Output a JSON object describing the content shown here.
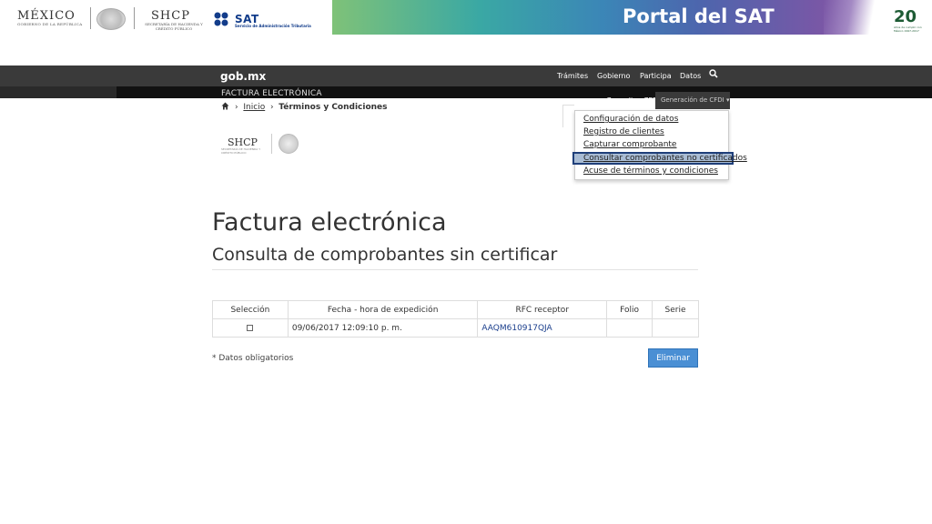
{
  "banner": {
    "mexico_title": "MÉXICO",
    "mexico_sub": "GOBIERNO DE LA REPÚBLICA",
    "shcp_title": "SHCP",
    "shcp_sub": "SECRETARÍA DE HACIENDA Y CRÉDITO PÚBLICO",
    "sat_name": "SAT",
    "sat_sub": "Servicio de Administración Tributaria",
    "portal_title": "Portal del SAT",
    "anniv_num": "20",
    "anniv_sub": "Años de cumplir con México 1997-2017"
  },
  "gobnav": {
    "logo": "gob.mx",
    "items": [
      "Trámites",
      "Gobierno",
      "Participa",
      "Datos"
    ],
    "search_icon": "search-icon"
  },
  "factbar": {
    "label": "FACTURA ELECTRÓNICA",
    "consultar_cfd": "Consultar CFD",
    "generacion_cfdi": "Generación de CFDI ▾"
  },
  "breadcrumb": {
    "home_icon": "home-icon",
    "inicio": "Inicio",
    "current": "Términos y Condiciones"
  },
  "dropdown": {
    "items": [
      "Configuración de datos",
      "Registro de clientes",
      "Capturar comprobante",
      "Consultar comprobantes no certificados",
      "Acuse de términos y condiciones"
    ],
    "highlighted_index": 3
  },
  "content_logo": {
    "title": "SHCP",
    "sub": "SECRETARÍA DE HACIENDA Y CRÉDITO PÚBLICO"
  },
  "page": {
    "title": "Factura electrónica",
    "subtitle": "Consulta de comprobantes sin certificar"
  },
  "table": {
    "headers": [
      "Selección",
      "Fecha - hora de expedición",
      "RFC receptor",
      "Folio",
      "Serie"
    ],
    "rows": [
      {
        "fecha": "09/06/2017 12:09:10 p. m.",
        "rfc": "AAQM610917QJA",
        "folio": "",
        "serie": ""
      }
    ]
  },
  "footer": {
    "required_note": "* Datos obligatorios",
    "eliminar": "Eliminar"
  },
  "colors": {
    "nav_bg": "#3a3a3a",
    "button_blue": "#4a8fd4",
    "link_blue": "#1a3e8c",
    "highlight_border": "#1f3f7a"
  }
}
